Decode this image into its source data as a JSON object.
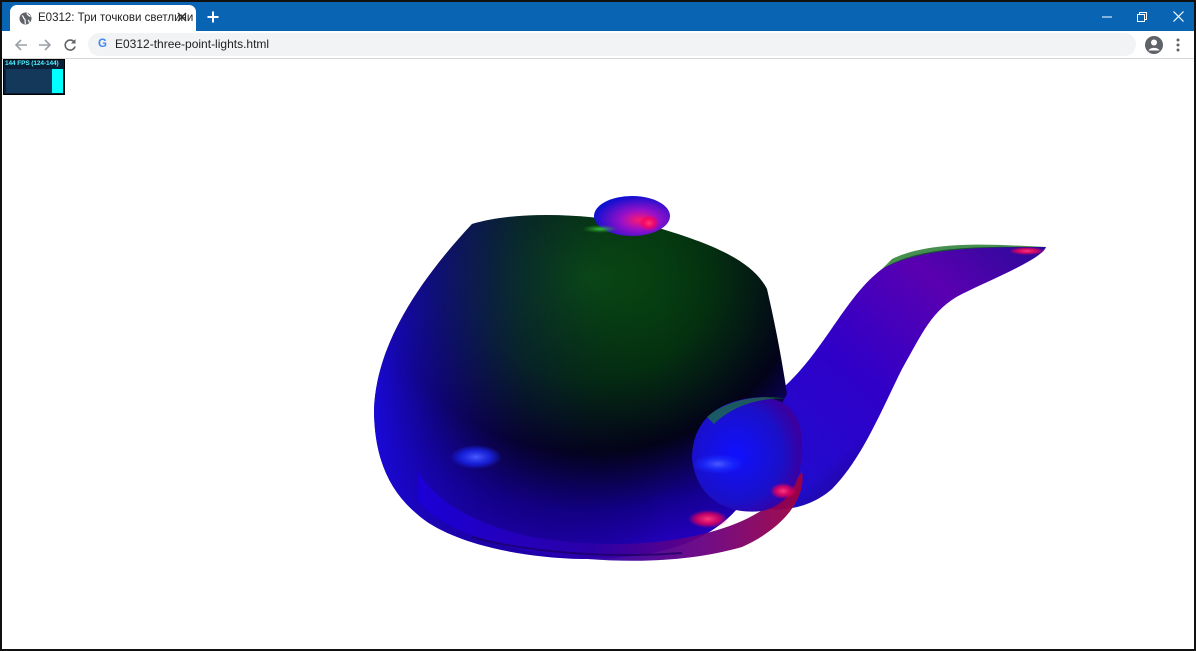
{
  "browser": {
    "tab": {
      "title": "E0312: Три точкови светлини",
      "icon": "globe-icon"
    },
    "url": "E0312-three-point-lights.html",
    "colors": {
      "titlebar": "#0a64b4",
      "omnibox": "#f1f3f4"
    }
  },
  "stats_panel": {
    "label": "144 FPS (124-144)",
    "fps": 144,
    "fps_min": 124,
    "fps_max": 144,
    "colors": {
      "fg": "#00ffff",
      "bg": "#0b1f36"
    }
  },
  "scene": {
    "object": "teapot",
    "lights": [
      "red",
      "green",
      "blue"
    ],
    "background": "#ffffff"
  }
}
